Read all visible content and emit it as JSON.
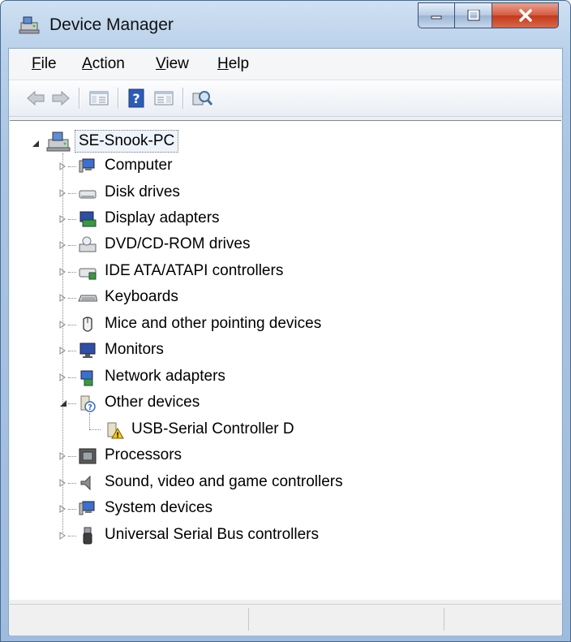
{
  "window": {
    "title": "Device Manager",
    "controls": [
      "minimize",
      "maximize",
      "close"
    ]
  },
  "menu": {
    "file": {
      "mnemonic": "F",
      "rest": "ile"
    },
    "action": {
      "mnemonic": "A",
      "rest": "ction"
    },
    "view": {
      "mnemonic": "V",
      "rest": "iew"
    },
    "help": {
      "mnemonic": "H",
      "rest": "elp"
    }
  },
  "toolbar": {
    "buttons": [
      "back-icon",
      "forward-icon",
      "show-hide-console-tree-icon",
      "help-icon",
      "show-hide-action-pane-icon",
      "scan-hardware-icon"
    ]
  },
  "tree": {
    "root": "SE-Snook-PC",
    "categories": [
      {
        "label": "Computer",
        "icon": "computer-icon",
        "expanded": false
      },
      {
        "label": "Disk drives",
        "icon": "disk-drive-icon",
        "expanded": false
      },
      {
        "label": "Display adapters",
        "icon": "display-adapter-icon",
        "expanded": false
      },
      {
        "label": "DVD/CD-ROM drives",
        "icon": "dvd-drive-icon",
        "expanded": false
      },
      {
        "label": "IDE ATA/ATAPI controllers",
        "icon": "ide-controller-icon",
        "expanded": false
      },
      {
        "label": "Keyboards",
        "icon": "keyboard-icon",
        "expanded": false
      },
      {
        "label": "Mice and other pointing devices",
        "icon": "mouse-icon",
        "expanded": false
      },
      {
        "label": "Monitors",
        "icon": "monitor-icon",
        "expanded": false
      },
      {
        "label": "Network adapters",
        "icon": "network-adapter-icon",
        "expanded": false
      },
      {
        "label": "Other devices",
        "icon": "unknown-device-icon",
        "expanded": true
      },
      {
        "label": "Processors",
        "icon": "processor-icon",
        "expanded": false
      },
      {
        "label": "Sound, video and game controllers",
        "icon": "sound-icon",
        "expanded": false
      },
      {
        "label": "System devices",
        "icon": "system-devices-icon",
        "expanded": false
      },
      {
        "label": "Universal Serial Bus controllers",
        "icon": "usb-icon",
        "expanded": false
      }
    ],
    "other_devices_children": [
      {
        "label": "USB-Serial Controller D",
        "icon": "warning-device-icon"
      }
    ]
  },
  "colors": {
    "titlebar": "#b9d1ea",
    "close_button": "#c3391b",
    "selection_fill": "#eef4fb"
  }
}
